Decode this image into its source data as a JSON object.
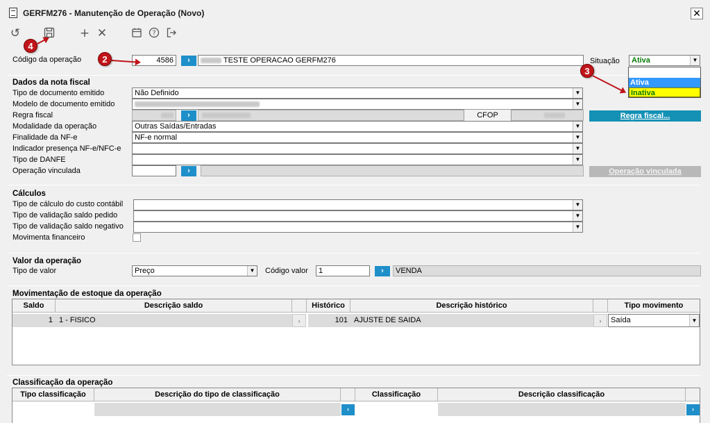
{
  "window": {
    "title": "GERFM276 - Manutenção de Operação (Novo)",
    "close_label": "✕"
  },
  "toolbar": {
    "icons": [
      "refresh-icon",
      "save-icon",
      "add-icon",
      "delete-icon",
      "calendar-icon",
      "help-icon",
      "exit-icon"
    ]
  },
  "markers": [
    "4",
    "2",
    "3"
  ],
  "header": {
    "codigo_label": "Código da operação",
    "codigo_value": "4586",
    "descricao_value": "TESTE OPERACAO GERFM276",
    "situacao_label": "Situação",
    "situacao_value": "Ativa",
    "situacao_options": [
      "Ativa",
      "Inativa"
    ]
  },
  "nota_fiscal": {
    "title": "Dados da nota fiscal",
    "tipo_documento_label": "Tipo de documento emitido",
    "tipo_documento_value": "Não Definido",
    "modelo_documento_label": "Modelo de documento emitido",
    "regra_fiscal_label": "Regra fiscal",
    "cfop_label": "CFOP",
    "modalidade_label": "Modalidade da operação",
    "modalidade_value": "Outras Saídas/Entradas",
    "finalidade_label": "Finalidade da NF-e",
    "finalidade_value": "NF-e normal",
    "indicador_label": "Indicador presença NF-e/NFC-e",
    "tipo_danfe_label": "Tipo de DANFE",
    "operacao_vinculada_label": "Operação vinculada",
    "regra_fiscal_button": "Regra fiscal...",
    "operacao_vinculada_button": "Operação vinculada"
  },
  "calculos": {
    "title": "Cálculos",
    "custo_label": "Tipo de cálculo do custo contábil",
    "saldo_pedido_label": "Tipo de validação saldo pedido",
    "saldo_negativo_label": "Tipo de validação saldo negativo",
    "movimenta_label": "Movimenta financeiro"
  },
  "valor": {
    "title": "Valor da operação",
    "tipo_label": "Tipo de valor",
    "tipo_value": "Preço",
    "codigo_label": "Código valor",
    "codigo_value": "1",
    "descricao_value": "VENDA"
  },
  "estoque": {
    "title": "Movimentação de estoque da operação",
    "columns": [
      "Saldo",
      "Descrição saldo",
      "Histórico",
      "Descrição histórico",
      "Tipo movimento"
    ],
    "row": {
      "saldo": "1",
      "descricao_saldo": "1 - FISICO",
      "historico": "101",
      "descricao_historico": "AJUSTE DE SAIDA",
      "tipo_movimento": "Saída"
    }
  },
  "classificacao": {
    "title": "Classificação da operação",
    "columns": [
      "Tipo classificação",
      "Descrição do tipo de classificação",
      "Classificação",
      "Descrição classificação"
    ]
  }
}
